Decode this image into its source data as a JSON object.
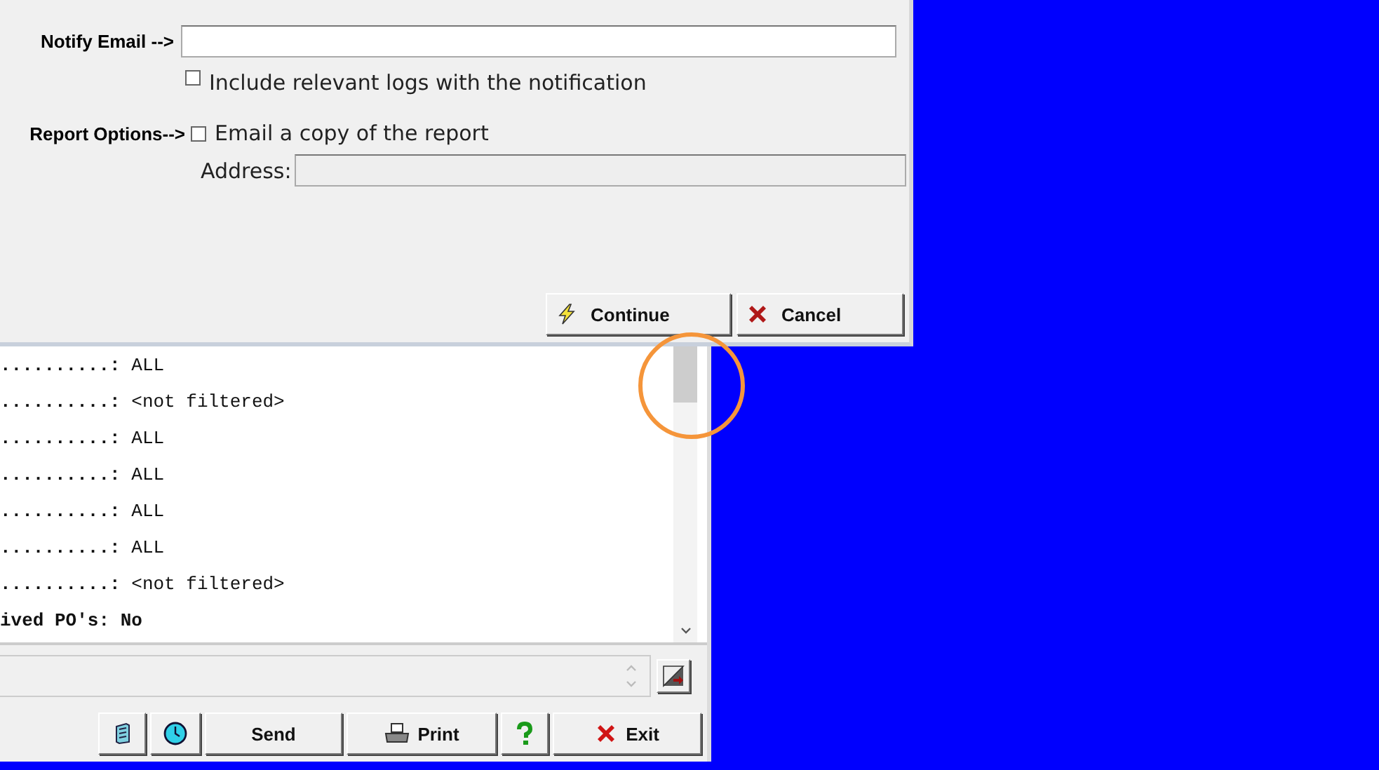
{
  "dialog": {
    "notify_email": {
      "label": "Notify Email -->"
    },
    "include_logs": {
      "label": "Include relevant logs with the notification",
      "checked": false
    },
    "report_options": {
      "label": "Report Options-->",
      "email_copy": {
        "label": "Email a copy of the report",
        "checked": false
      },
      "address": {
        "label": "Address:",
        "disabled": true
      }
    },
    "buttons": [
      {
        "kind": "continue",
        "label": "Continue"
      },
      {
        "kind": "cancel",
        "label": "Cancel"
      }
    ]
  },
  "log": {
    "lines": [
      {
        "label": "..........:",
        "value": "ALL",
        "emphasis": false
      },
      {
        "label": "..........:",
        "value": "<not filtered>",
        "emphasis": false
      },
      {
        "label": "..........:",
        "value": "ALL",
        "emphasis": false
      },
      {
        "label": "..........:",
        "value": "ALL",
        "emphasis": false
      },
      {
        "label": "..........:",
        "value": "ALL",
        "emphasis": false
      },
      {
        "label": "..........:",
        "value": "ALL",
        "emphasis": false
      },
      {
        "label": "..........:",
        "value": "<not filtered>",
        "emphasis": false
      },
      {
        "label": "ived PO's:",
        "value": "No",
        "emphasis": true
      }
    ]
  },
  "toolbar": [
    {
      "kind": "cabinet"
    },
    {
      "kind": "clock"
    },
    {
      "kind": "send",
      "label": "Send"
    },
    {
      "kind": "print",
      "label": "Print"
    },
    {
      "kind": "help"
    },
    {
      "kind": "exit",
      "label": "Exit"
    }
  ]
}
